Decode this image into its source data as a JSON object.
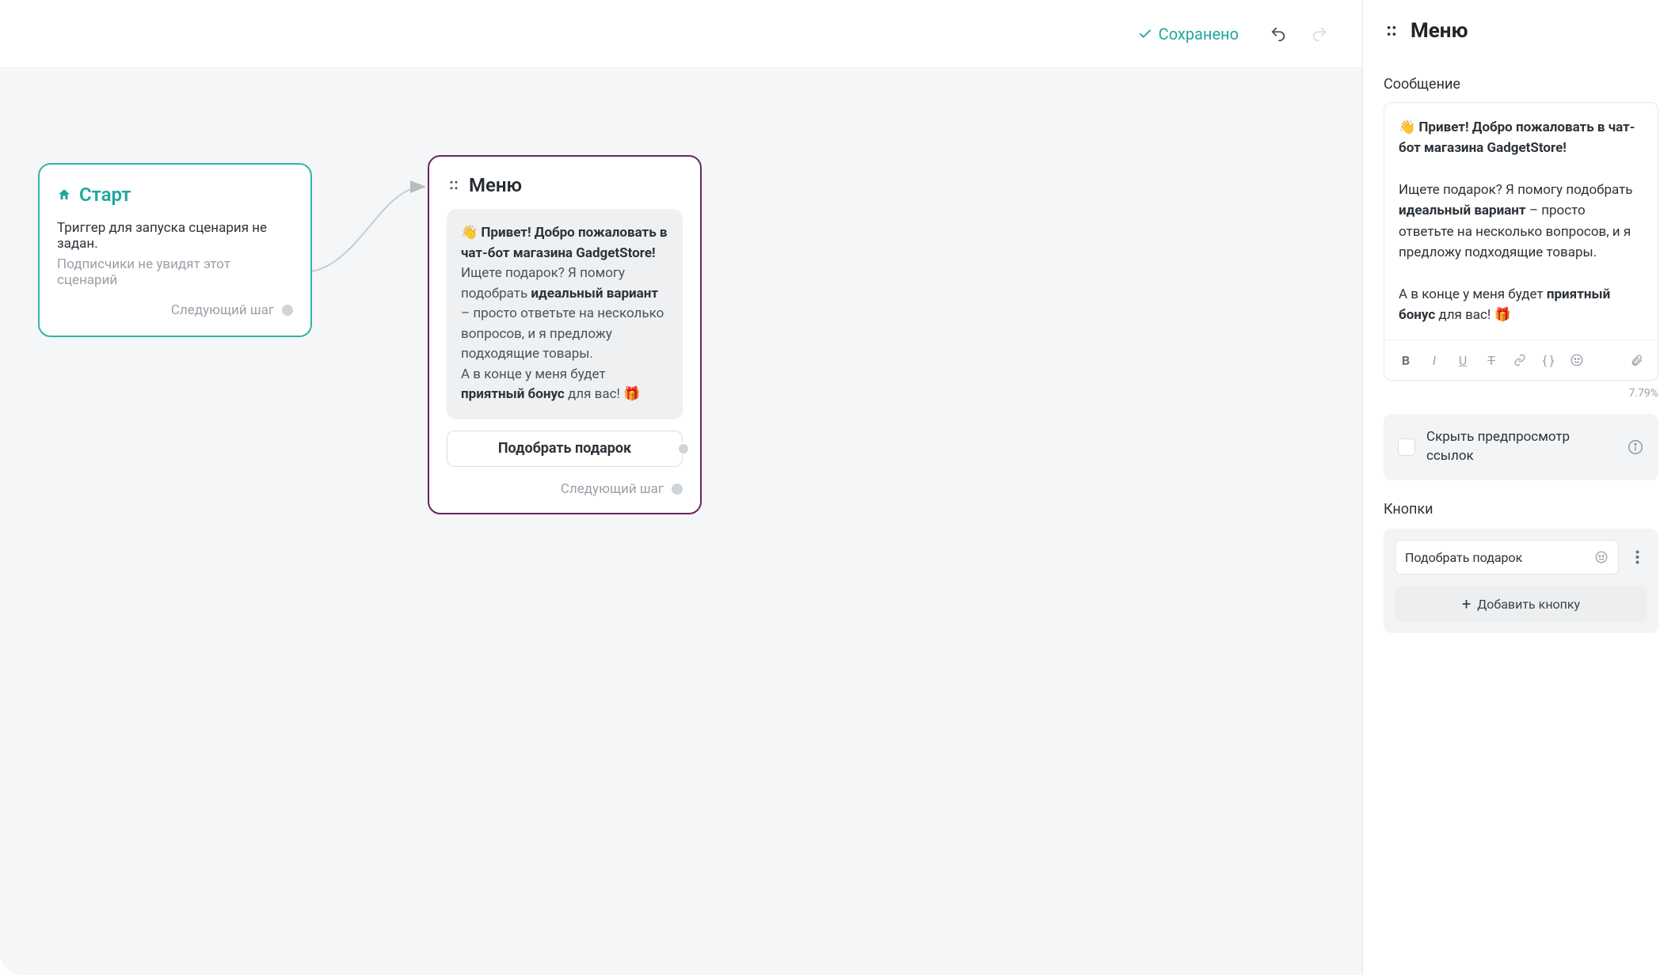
{
  "topbar": {
    "saved_label": "Сохранено"
  },
  "start_node": {
    "title": "Старт",
    "line1": "Триггер для запуска сценария не задан.",
    "line2": "Подписчики не увидят этот сценарий",
    "next_step_label": "Следующий шаг"
  },
  "menu_node": {
    "title": "Меню",
    "greet_emoji": "👋",
    "greet_bold": "Привет! Добро пожаловать в чат-бот магазина GadgetStore!",
    "p1_a": "Ищете подарок? Я помогу подобрать ",
    "p1_bold": "идеальный вариант",
    "p1_b": " – просто ответьте на несколько вопросов, и я предложу подходящие товары.",
    "p2_a": "А в конце у меня будет ",
    "p2_bold": "приятный бонус",
    "p2_b": " для вас! ",
    "gift_emoji": "🎁",
    "cta_label": "Подобрать подарок",
    "next_step_label": "Следующий шаг"
  },
  "panel": {
    "title": "Меню",
    "section_message": "Сообщение",
    "editor": {
      "greet_emoji": "👋",
      "greet_bold": "Привет! Добро пожаловать в чат-бот магазина GadgetStore!",
      "p1_a": "Ищете подарок? Я помогу подобрать ",
      "p1_bold": "идеальный вариант",
      "p1_b": " – просто ответьте на несколько вопросов, и я предложу подходящие товары.",
      "p2_a": "А в конце у меня будет ",
      "p2_bold": "приятный бонус",
      "p2_b": " для вас! ",
      "gift_emoji": "🎁"
    },
    "percent": "7.79%",
    "hide_preview_label": "Скрыть предпросмотр ссылок",
    "section_buttons": "Кнопки",
    "button_value": "Подобрать подарок",
    "add_button_label": "Добавить кнопку"
  }
}
